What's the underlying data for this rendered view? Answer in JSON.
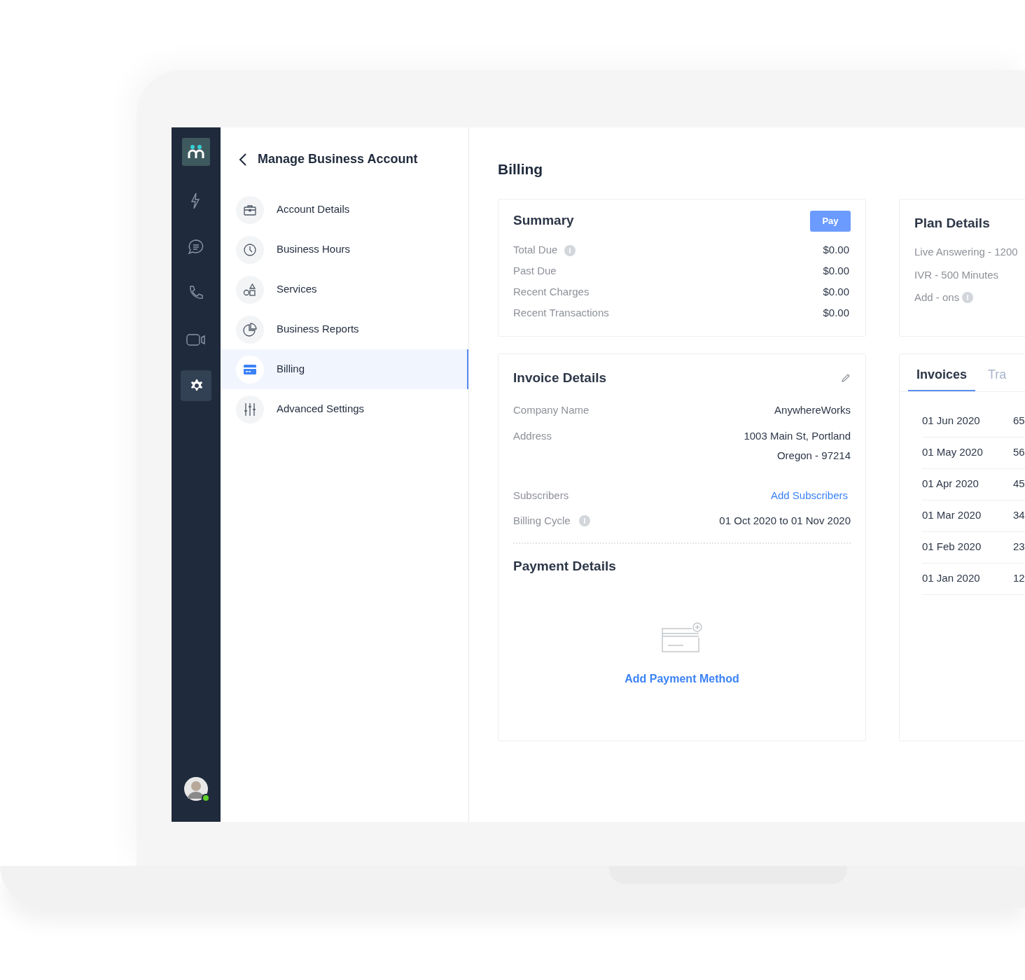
{
  "rail": {
    "items": [
      {
        "selected": false
      },
      {
        "selected": false
      },
      {
        "selected": false
      },
      {
        "selected": false
      },
      {
        "selected": true
      }
    ],
    "user": {
      "online": true
    }
  },
  "nav": {
    "title": "Manage Business Account",
    "items": [
      {
        "label": "Account Details",
        "selected": false
      },
      {
        "label": "Business Hours",
        "selected": false
      },
      {
        "label": "Services",
        "selected": false
      },
      {
        "label": "Business Reports",
        "selected": false
      },
      {
        "label": "Billing",
        "selected": true
      },
      {
        "label": "Advanced Settings",
        "selected": false
      }
    ]
  },
  "page_title": "Billing",
  "summary": {
    "title": "Summary",
    "button": "Pay",
    "rows": [
      {
        "label": "Total Due",
        "info": true,
        "value": "$0.00"
      },
      {
        "label": "Past Due",
        "info": false,
        "value": "$0.00"
      },
      {
        "label": "Recent Charges",
        "info": false,
        "value": "$0.00"
      },
      {
        "label": "Recent Transactions",
        "info": false,
        "value": "$0.00"
      }
    ]
  },
  "plan": {
    "title": "Plan Details",
    "rows": [
      {
        "text": "Live Answering - 1200",
        "info": false
      },
      {
        "text": "IVR - 500 Minutes",
        "info": false
      },
      {
        "text": "Add - ons",
        "info": true
      }
    ]
  },
  "invoice_details": {
    "title": "Invoice Details",
    "rows": [
      {
        "label": "Company Name",
        "kind": "text",
        "info": false,
        "value": [
          "AnywhereWorks"
        ]
      },
      {
        "label": "Address",
        "kind": "text",
        "info": false,
        "value": [
          "1003 Main St, Portland",
          "Oregon - 97214"
        ]
      },
      {
        "label": "Subscribers",
        "kind": "link",
        "info": false,
        "value": [
          "Add Subscribers"
        ]
      },
      {
        "label": "Billing Cycle",
        "kind": "text",
        "info": true,
        "value": [
          "01 Oct 2020 to 01 Nov 2020"
        ]
      }
    ]
  },
  "payment": {
    "title": "Payment Details",
    "action": "Add Payment Method"
  },
  "invoices": {
    "tabs": [
      {
        "label": "Invoices",
        "selected": true
      },
      {
        "label": "Tra",
        "selected": false
      }
    ],
    "rows": [
      {
        "date": "01 Jun 2020",
        "column_2": "65"
      },
      {
        "date": "01 May 2020",
        "column_2": "56"
      },
      {
        "date": "01 Apr 2020",
        "column_2": "45"
      },
      {
        "date": "01 Mar 2020",
        "column_2": "34"
      },
      {
        "date": "01 Feb 2020",
        "column_2": "23"
      },
      {
        "date": "01 Jan 2020",
        "column_2": "12"
      }
    ]
  }
}
